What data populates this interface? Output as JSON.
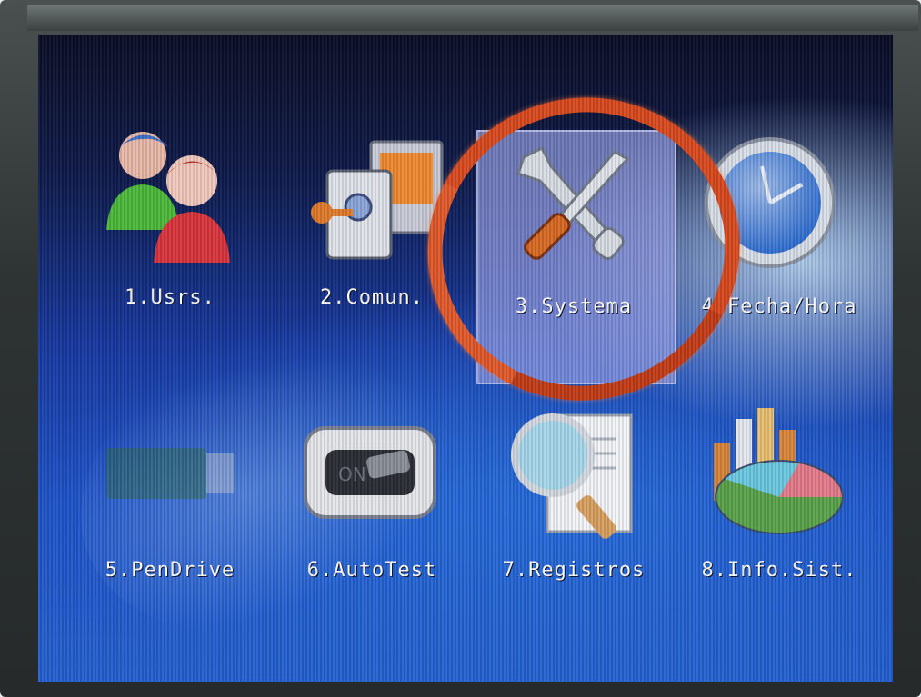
{
  "menu": {
    "items": [
      {
        "label": "1.Usrs.",
        "icon": "users-icon"
      },
      {
        "label": "2.Comun.",
        "icon": "communication-icon"
      },
      {
        "label": "3.Systema",
        "icon": "tools-icon"
      },
      {
        "label": "4.Fecha/Hora",
        "icon": "clock-icon"
      },
      {
        "label": "5.PenDrive",
        "icon": "pendrive-icon"
      },
      {
        "label": "6.AutoTest",
        "icon": "autotest-icon"
      },
      {
        "label": "7.Registros",
        "icon": "search-document-icon"
      },
      {
        "label": "8.Info.Sist.",
        "icon": "chart-icon"
      }
    ],
    "selected_index": 2
  },
  "colors": {
    "highlight_ring": "#d84a1f",
    "selection_box": "#96a0e6",
    "label_text": "#ffffff",
    "screen_blue": "#1e52c8"
  }
}
